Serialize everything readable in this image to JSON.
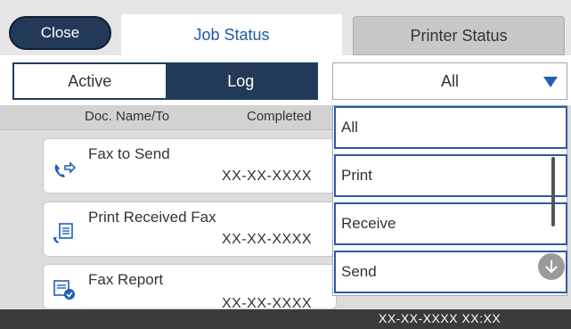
{
  "header": {
    "close_label": "Close",
    "tab_job_status": "Job Status",
    "tab_printer_status": "Printer Status"
  },
  "segment": {
    "active_label": "Active",
    "log_label": "Log"
  },
  "filter": {
    "selected": "All"
  },
  "columns": {
    "doc_name": "Doc. Name/To",
    "completed": "Completed"
  },
  "jobs": [
    {
      "title": "Fax to Send",
      "date": "XX-XX-XXXX",
      "icon": "fax-send-icon"
    },
    {
      "title": "Print Received Fax",
      "date": "XX-XX-XXXX",
      "icon": "fax-print-icon"
    },
    {
      "title": "Fax Report",
      "date": "XX-XX-XXXX",
      "icon": "fax-report-icon"
    }
  ],
  "dropdown_options": [
    "All",
    "Print",
    "Receive",
    "Send"
  ],
  "status_bar": {
    "datetime": "XX-XX-XXXX XX:XX"
  },
  "colors": {
    "navy": "#223a57",
    "accent_blue": "#1f5fb8"
  }
}
